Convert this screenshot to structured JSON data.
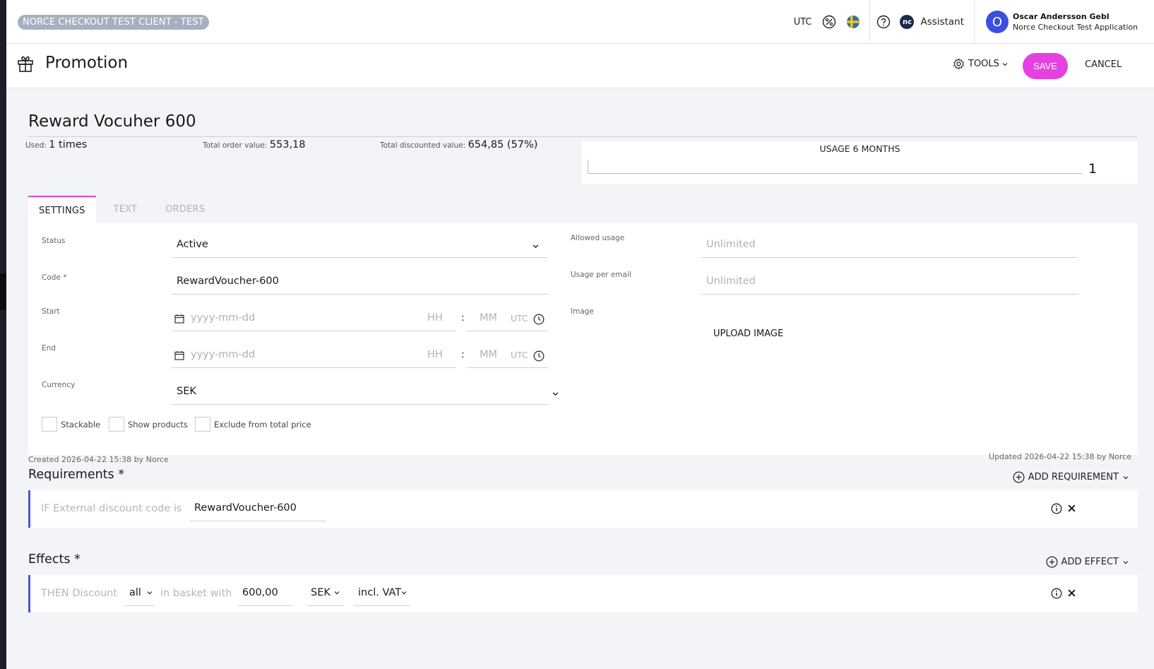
{
  "header": {
    "env_badge": "NORCE CHECKOUT TEST CLIENT - TEST",
    "timezone": "UTC",
    "assistant_label": "Assistant",
    "assistant_icon_text": "nc",
    "user_initial": "O",
    "user_name": "Oscar Andersson Gebl",
    "user_app": "Norce Checkout Test Application"
  },
  "titlebar": {
    "title": "Promotion",
    "tools_label": "TOOLS",
    "save_label": "SAVE",
    "cancel_label": "CANCEL"
  },
  "promotion": {
    "name": "Reward Vocuher 600",
    "used_label": "Used:",
    "used_value": "1 times",
    "total_order_label": "Total order value:",
    "total_order_value": "553,18",
    "total_discounted_label": "Total discounted value:",
    "total_discounted_value": "654,85 (57%)",
    "usage_title": "USAGE 6 MONTHS",
    "usage_value": "1"
  },
  "tabs": [
    {
      "label": "SETTINGS",
      "active": true
    },
    {
      "label": "TEXT",
      "active": false
    },
    {
      "label": "ORDERS",
      "active": false
    }
  ],
  "settings": {
    "status_label": "Status",
    "status_value": "Active",
    "code_label": "Code *",
    "code_value": "RewardVoucher-600",
    "start_label": "Start",
    "end_label": "End",
    "date_placeholder": "yyyy-mm-dd",
    "hour_placeholder": "HH",
    "minute_placeholder": "MM",
    "time_sep": ":",
    "tz_label": "UTC",
    "currency_label": "Currency",
    "currency_value": "SEK",
    "allowed_usage_label": "Allowed usage",
    "allowed_usage_placeholder": "Unlimited",
    "usage_per_email_label": "Usage per email",
    "usage_per_email_placeholder": "Unlimited",
    "image_label": "Image",
    "upload_label": "UPLOAD IMAGE",
    "stackable_label": "Stackable",
    "show_products_label": "Show products",
    "exclude_label": "Exclude from total price"
  },
  "meta": {
    "created": "Created 2026-04-22 15:38 by Norce",
    "updated": "Updated 2026-04-22 15:38 by Norce"
  },
  "requirements": {
    "title": "Requirements *",
    "add_label": "ADD REQUIREMENT",
    "rule_keyword": "IF External discount code is",
    "rule_value": "RewardVoucher-600"
  },
  "effects": {
    "title": "Effects *",
    "add_label": "ADD EFFECT",
    "kw_then": "THEN Discount",
    "scope": "all",
    "kw_in": "in basket with",
    "amount": "600,00",
    "currency": "SEK",
    "vat": "incl. VAT"
  }
}
